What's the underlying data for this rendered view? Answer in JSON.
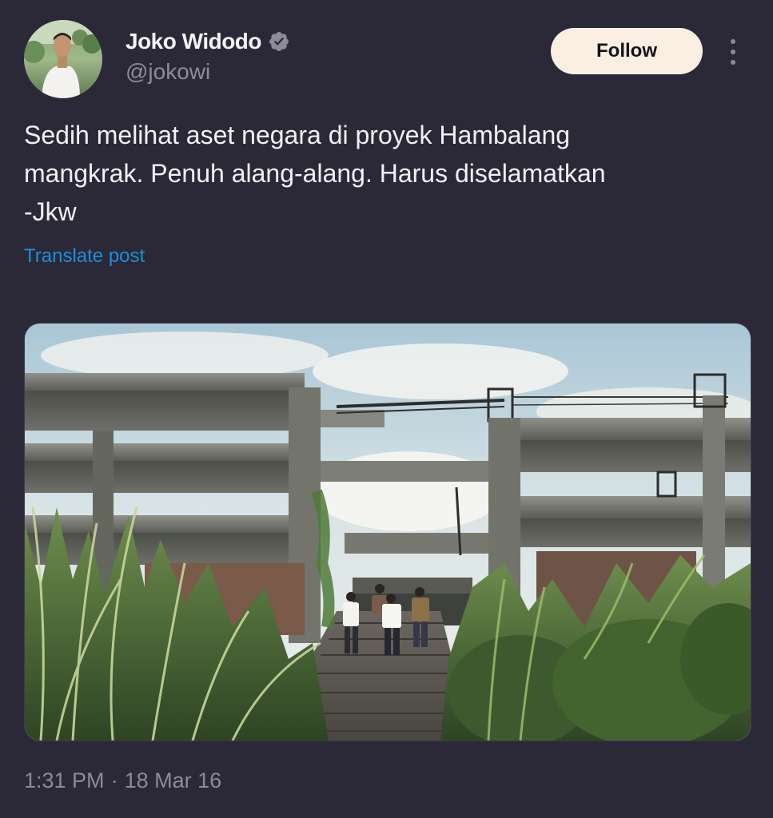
{
  "author": {
    "display_name": "Joko Widodo",
    "handle": "@jokowi",
    "verified": true,
    "avatar_icon": "profile-photo"
  },
  "actions": {
    "follow_label": "Follow",
    "more_icon": "vertical-ellipsis-icon"
  },
  "post": {
    "text": "Sedih melihat aset negara di proyek Hambalang\nmangkrak. Penuh alang-alang. Harus diselamatkan\n-Jkw",
    "translate_label": "Translate post"
  },
  "media": {
    "type": "photo",
    "subject": "abandoned-concrete-building-with-tall-grass"
  },
  "meta": {
    "time": "1:31 PM",
    "separator": "·",
    "date": "18 Mar 16"
  },
  "colors": {
    "background": "#2b2838",
    "text": "#f2f0f6",
    "secondary_text": "#8e8a9b",
    "link": "#1e8fd6",
    "follow_button_bg": "#fbeee3",
    "verified_badge": "#8e8a9b"
  }
}
